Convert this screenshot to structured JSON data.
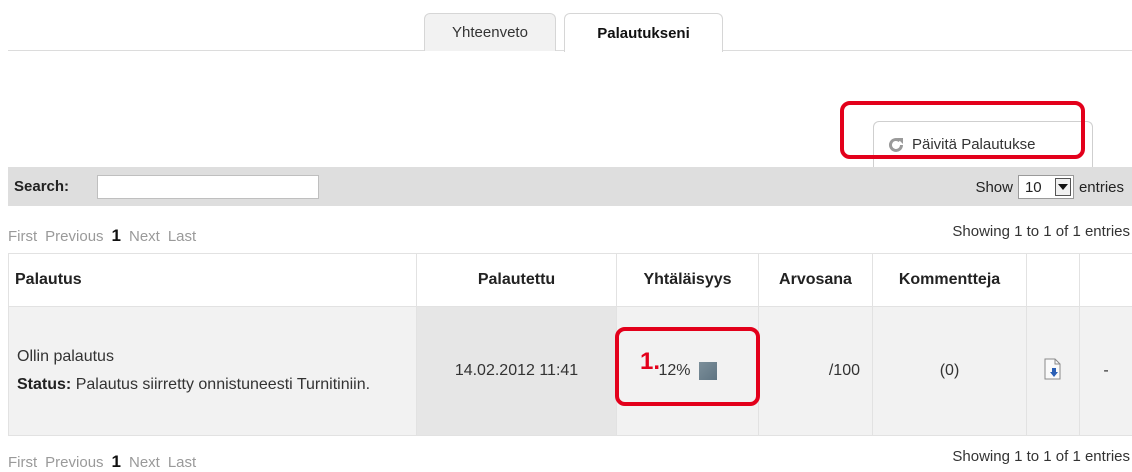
{
  "tabs": [
    {
      "label": "Yhteenveto"
    },
    {
      "label": "Palautukseni"
    }
  ],
  "refresh_button": {
    "label": "Päivitä Palautukse",
    "icon": "refresh-icon"
  },
  "search": {
    "label": "Search:",
    "value": ""
  },
  "length_menu": {
    "prefix": "Show",
    "selected": "10",
    "suffix": "entries"
  },
  "pagination": {
    "first": "First",
    "previous": "Previous",
    "current": "1",
    "next": "Next",
    "last": "Last"
  },
  "info_text": "Showing 1 to 1 of 1 entries",
  "table": {
    "headers": [
      "Palautus",
      "Palautettu",
      "Yhtäläisyys",
      "Arvosana",
      "Kommentteja",
      "",
      ""
    ],
    "rows": [
      {
        "title": "Ollin palautus",
        "status_label": "Status:",
        "status_text": "Palautus siirretty onnistuneesti Turnitiniin.",
        "date": "14.02.2012 11:41",
        "similarity": "12%",
        "grade": "/100",
        "comments": "(0)",
        "download_icon": "download-document-icon",
        "last": "-"
      }
    ]
  },
  "annotations": {
    "callout_number": "1."
  },
  "colors": {
    "highlight": "#e3001b",
    "header_bar": "#dedede"
  }
}
